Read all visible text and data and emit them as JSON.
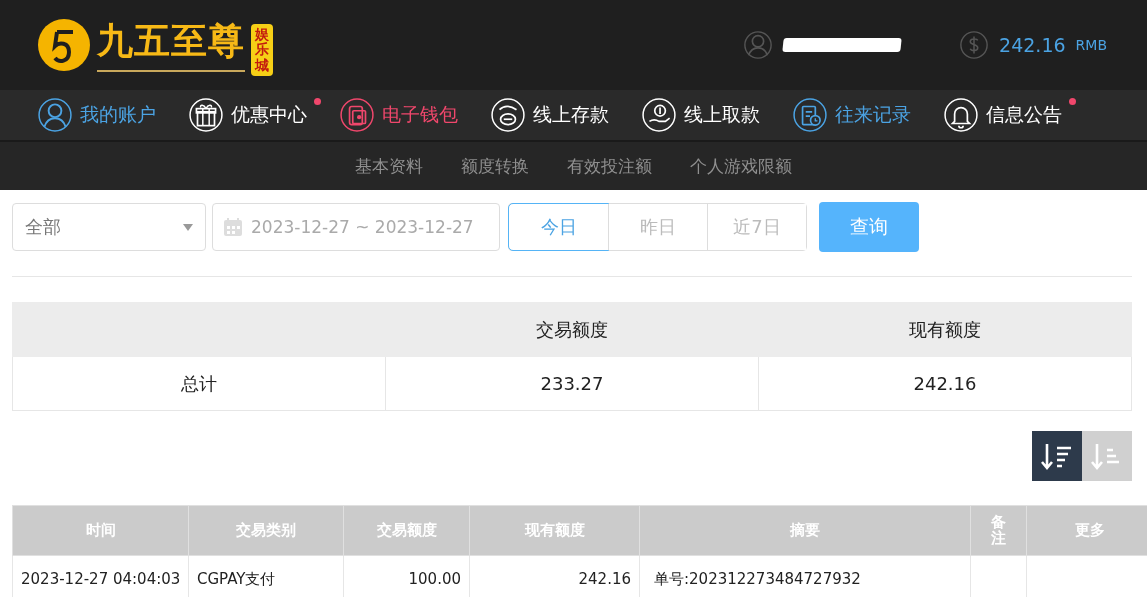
{
  "logo": {
    "title": "九五至尊",
    "badge": "娱乐城"
  },
  "account": {
    "balance": "242.16",
    "currency": "RMB"
  },
  "nav": [
    {
      "label": "我的账户",
      "kind": "user",
      "color": "#4ba3e3",
      "dot": false
    },
    {
      "label": "优惠中心",
      "kind": "gift",
      "color": "#ffffff",
      "dot": true
    },
    {
      "label": "电子钱包",
      "kind": "wallet",
      "color": "#f0476c",
      "dot": false
    },
    {
      "label": "线上存款",
      "kind": "deposit",
      "color": "#ffffff",
      "dot": false
    },
    {
      "label": "线上取款",
      "kind": "withdraw",
      "color": "#ffffff",
      "dot": false
    },
    {
      "label": "往来记录",
      "kind": "records",
      "color": "#4ba3e3",
      "dot": false
    },
    {
      "label": "信息公告",
      "kind": "bell",
      "color": "#ffffff",
      "dot": true
    }
  ],
  "subnav": [
    "基本资料",
    "额度转换",
    "有效投注额",
    "个人游戏限额"
  ],
  "filter": {
    "type": "全部",
    "date_range": "2023-12-27 ~ 2023-12-27",
    "quick_dates": [
      {
        "label": "今日",
        "selected": true
      },
      {
        "label": "昨日",
        "selected": false
      },
      {
        "label": "近7日",
        "selected": false
      }
    ],
    "search_button": "查询"
  },
  "summary": {
    "columns": [
      "交易额度",
      "现有额度"
    ],
    "rows": [
      {
        "label": "总计",
        "values": [
          "233.27",
          "242.16"
        ]
      }
    ]
  },
  "sort": [
    {
      "kind": "desc",
      "selected": true
    },
    {
      "kind": "asc",
      "selected": false
    }
  ],
  "records": {
    "columns": [
      "时间",
      "交易类别",
      "交易额度",
      "现有额度",
      "摘要",
      "备注",
      "更多"
    ],
    "rows": [
      [
        "2023-12-27 04:04:03",
        "CGPAY支付",
        "100.00",
        "242.16",
        "单号:202312273484727932"
      ]
    ]
  }
}
